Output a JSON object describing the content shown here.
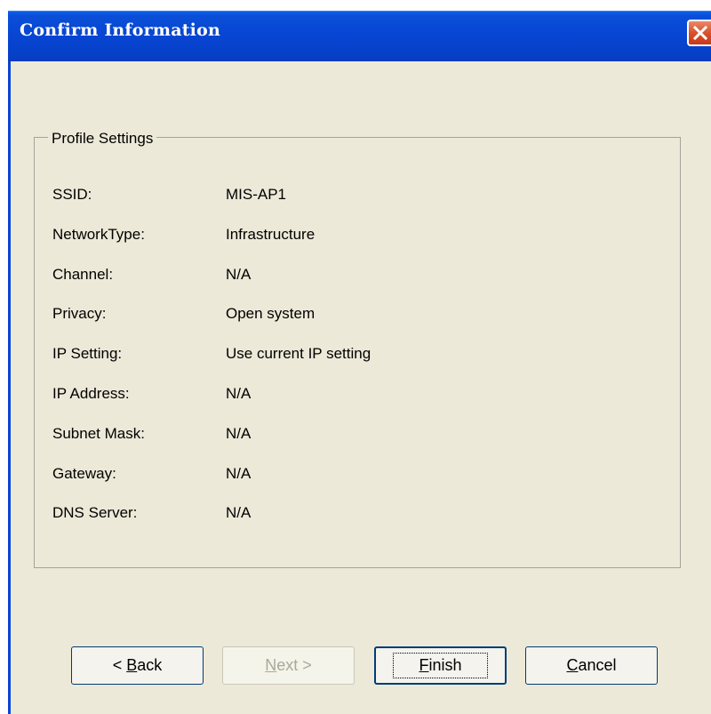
{
  "window": {
    "title": "Confirm Information"
  },
  "group": {
    "label": "Profile Settings",
    "rows": [
      {
        "label": "SSID:",
        "value": "MIS-AP1"
      },
      {
        "label": "NetworkType:",
        "value": "Infrastructure"
      },
      {
        "label": "Channel:",
        "value": "N/A"
      },
      {
        "label": "Privacy:",
        "value": "Open system"
      },
      {
        "label": "IP Setting:",
        "value": "Use current IP setting"
      },
      {
        "label": "IP Address:",
        "value": "N/A"
      },
      {
        "label": "Subnet Mask:",
        "value": "N/A"
      },
      {
        "label": "Gateway:",
        "value": "N/A"
      },
      {
        "label": "DNS Server:",
        "value": "N/A"
      }
    ]
  },
  "buttons": {
    "back": {
      "prefix": "< ",
      "mnemonic": "B",
      "rest": "ack"
    },
    "next": {
      "mnemonic": "N",
      "rest": "ext >"
    },
    "finish": {
      "mnemonic": "F",
      "rest": "inish"
    },
    "cancel": {
      "mnemonic": "C",
      "rest": "ancel"
    }
  }
}
